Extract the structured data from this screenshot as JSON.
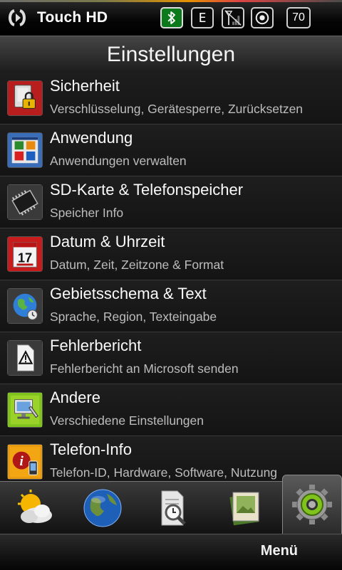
{
  "status_bar": {
    "device_name": "Touch HD",
    "network_type": "E",
    "battery_level": "70",
    "icons": [
      "start-icon",
      "bluetooth-icon",
      "edge-icon",
      "signal-icon",
      "volume-icon",
      "battery-icon"
    ]
  },
  "header": {
    "title": "Einstellungen"
  },
  "settings": {
    "items": [
      {
        "title": "Sicherheit",
        "subtitle": "Verschlüsselung, Gerätesperre, Zurücksetzen",
        "icon": "lock-icon"
      },
      {
        "title": "Anwendung",
        "subtitle": "Anwendungen verwalten",
        "icon": "apps-icon"
      },
      {
        "title": "SD-Karte & Telefonspeicher",
        "subtitle": "Speicher Info",
        "icon": "memory-chip-icon"
      },
      {
        "title": "Datum & Uhrzeit",
        "subtitle": "Datum, Zeit, Zeitzone & Format",
        "icon": "calendar-icon",
        "calendar_day": "17"
      },
      {
        "title": "Gebietsschema & Text",
        "subtitle": "Sprache, Region, Texteingabe",
        "icon": "globe-icon"
      },
      {
        "title": "Fehlerbericht",
        "subtitle": "Fehlerbericht an Microsoft senden",
        "icon": "warning-icon"
      },
      {
        "title": "Andere",
        "subtitle": "Verschiedene Einstellungen",
        "icon": "tools-icon"
      },
      {
        "title": "Telefon-Info",
        "subtitle": "Telefon-ID, Hardware, Software, Nutzung",
        "icon": "info-icon"
      }
    ]
  },
  "tabs": [
    {
      "name": "weather",
      "icon": "weather-icon"
    },
    {
      "name": "internet",
      "icon": "globe-icon"
    },
    {
      "name": "documents",
      "icon": "document-search-icon"
    },
    {
      "name": "photos",
      "icon": "photo-album-icon"
    },
    {
      "name": "settings",
      "icon": "gear-icon",
      "active": true
    }
  ],
  "softkeys": {
    "right": "Menü"
  },
  "colors": {
    "accent_green": "#7fc31c",
    "bluetooth_green": "#0c7a1a"
  }
}
